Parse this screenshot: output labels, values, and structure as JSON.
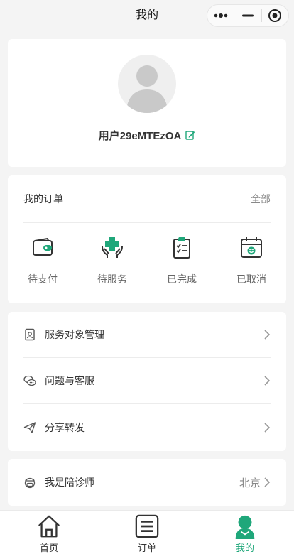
{
  "nav": {
    "title": "我的"
  },
  "profile": {
    "username": "用户29eMTEzOA"
  },
  "orders": {
    "title": "我的订单",
    "all_label": "全部",
    "items": [
      {
        "label": "待支付",
        "icon": "wallet-icon"
      },
      {
        "label": "待服务",
        "icon": "medical-care-icon"
      },
      {
        "label": "已完成",
        "icon": "clipboard-check-icon"
      },
      {
        "label": "已取消",
        "icon": "calendar-refresh-icon"
      }
    ]
  },
  "menu": {
    "items": [
      {
        "label": "服务对象管理",
        "icon": "id-card-icon"
      },
      {
        "label": "问题与客服",
        "icon": "chat-bubbles-icon"
      },
      {
        "label": "分享转发",
        "icon": "paper-plane-icon"
      }
    ]
  },
  "escort": {
    "label": "我是陪诊师",
    "city": "北京",
    "icon": "nurse-icon"
  },
  "tabbar": {
    "items": [
      {
        "label": "首页",
        "icon": "home-icon"
      },
      {
        "label": "订单",
        "icon": "list-icon"
      },
      {
        "label": "我的",
        "icon": "user-icon",
        "active": true
      }
    ]
  },
  "colors": {
    "accent": "#1fa77a",
    "background": "#f4f4f4"
  }
}
